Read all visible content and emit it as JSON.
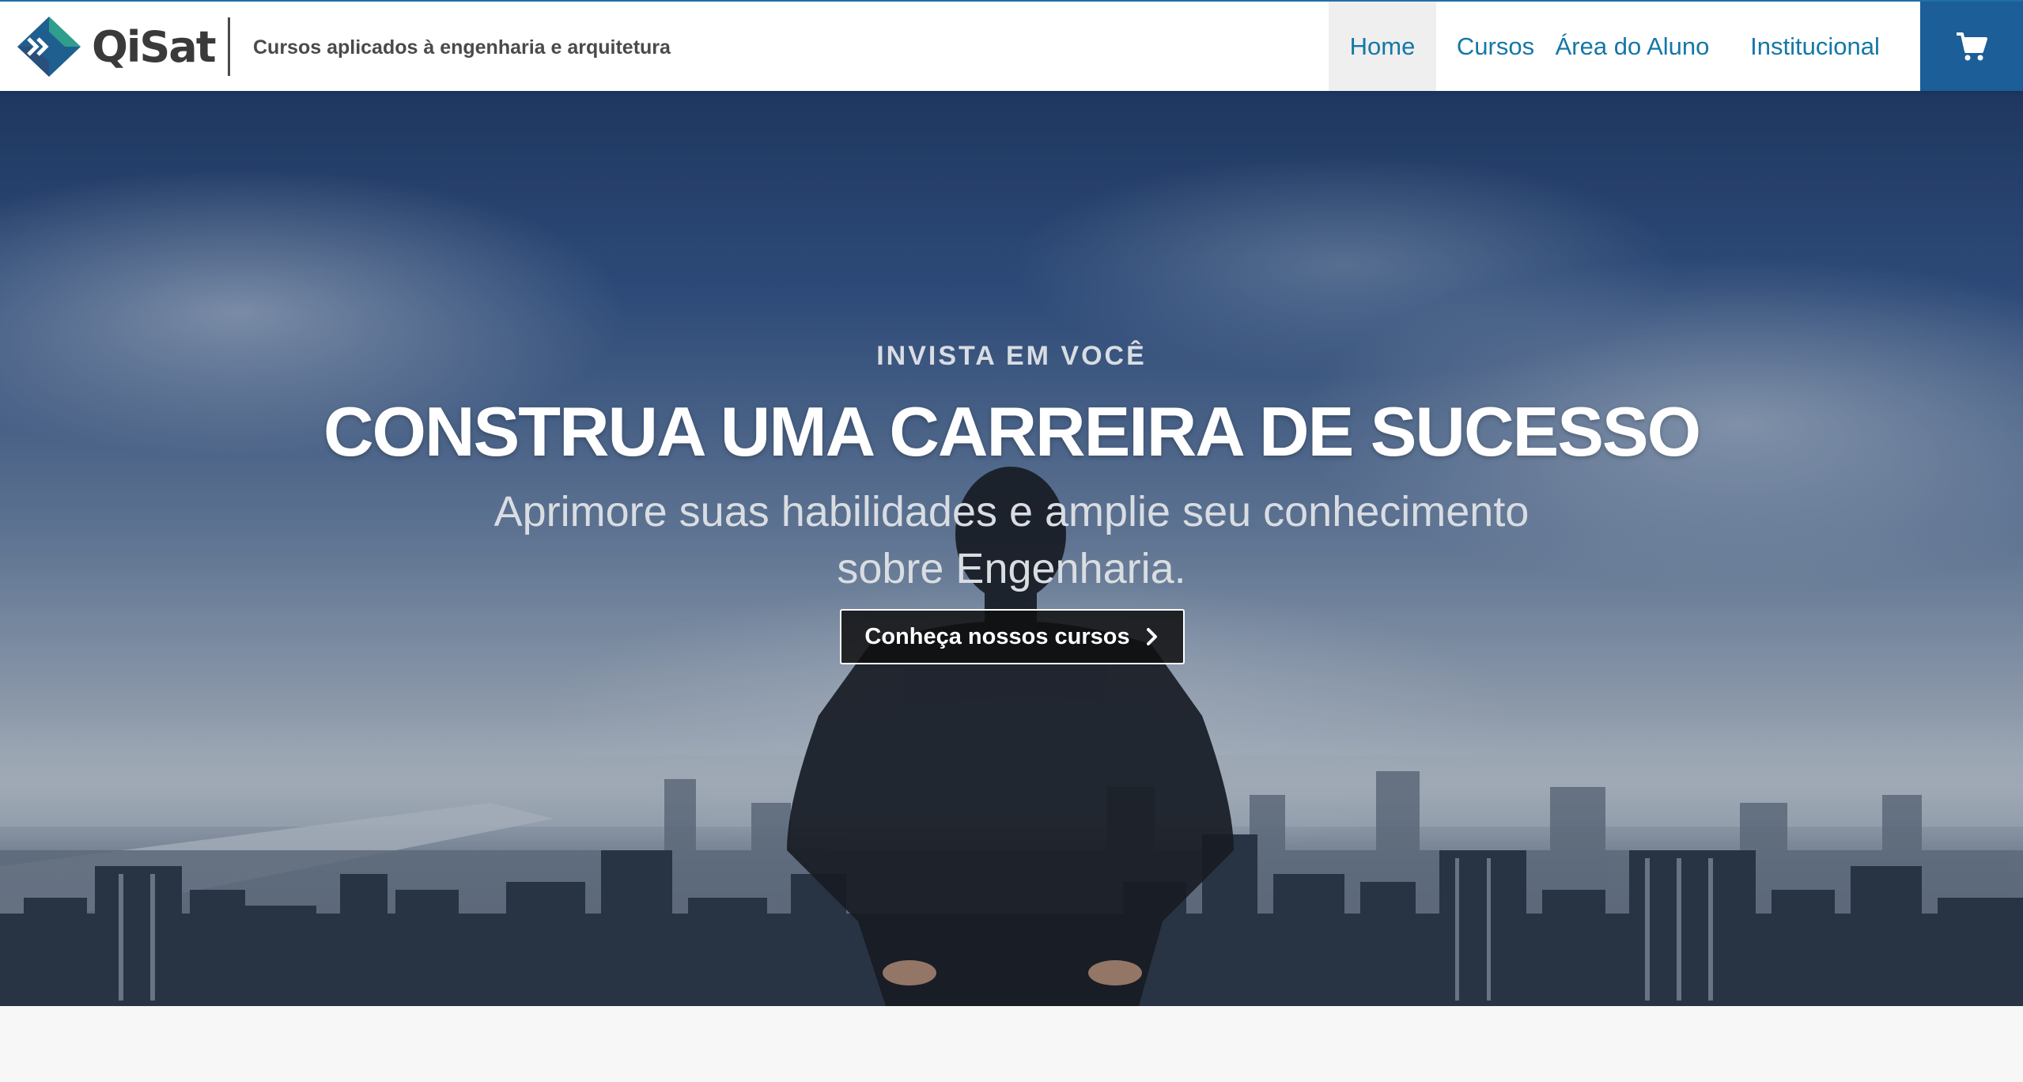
{
  "header": {
    "logo_text": "QiSat",
    "tagline": "Cursos aplicados à engenharia e arquitetura",
    "nav": [
      {
        "label": "Home",
        "active": true
      },
      {
        "label": "Cursos",
        "active": false
      },
      {
        "label": "Área do Aluno",
        "active": false
      },
      {
        "label": "Institucional",
        "active": false
      }
    ],
    "cart_icon": "shopping-cart-icon"
  },
  "hero": {
    "eyebrow": "INVISTA EM VOCÊ",
    "title": "CONSTRUA UMA CARREIRA DE SUCESSO",
    "subtitle": "Aprimore suas habilidades e amplie seu conhecimento sobre Engenharia.",
    "cta_label": "Conheça nossos cursos",
    "cta_icon": "chevron-right-icon"
  },
  "colors": {
    "brand_blue": "#1b5e98",
    "link_blue": "#1577a6",
    "logo_green": "#2f9e8a"
  }
}
